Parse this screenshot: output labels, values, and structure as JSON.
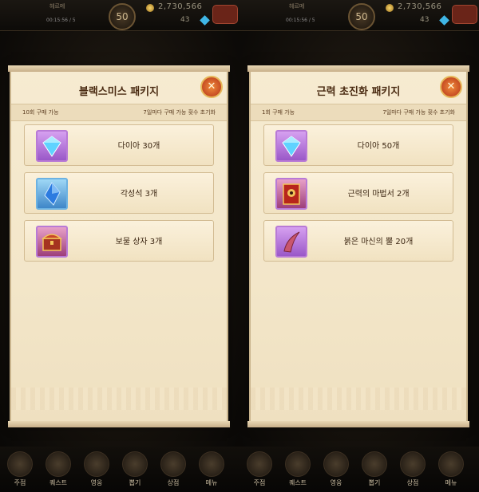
{
  "panels": [
    {
      "hud": {
        "player": "헤르메",
        "timer": "00:15:56 / 5",
        "level": "50",
        "gold": "2,730,566",
        "gems": "43"
      },
      "dialog": {
        "title": "블랙스미스 패키지",
        "purchase_limit": "10회 구매 가능",
        "reset_note": "7일마다 구매 가능 횟수 초기화",
        "items": [
          {
            "label": "다이아 30개",
            "icon": "diamond-icon"
          },
          {
            "label": "각성석 3개",
            "icon": "awakening-stone-icon"
          },
          {
            "label": "보물 상자 3개",
            "icon": "treasure-chest-icon"
          }
        ]
      },
      "nav": [
        "주점",
        "퀘스트",
        "영웅",
        "뽑기",
        "상점",
        "메뉴"
      ]
    },
    {
      "hud": {
        "player": "헤르메",
        "timer": "00:15:56 / 5",
        "level": "50",
        "gold": "2,730,566",
        "gems": "43"
      },
      "dialog": {
        "title": "근력 초진화 패키지",
        "purchase_limit": "1회 구매 가능",
        "reset_note": "7일마다 구매 가능 횟수 초기화",
        "items": [
          {
            "label": "다이아 50개",
            "icon": "diamond-icon"
          },
          {
            "label": "근력의 마법서 2개",
            "icon": "spellbook-icon"
          },
          {
            "label": "붉은 마신의 뿔 20개",
            "icon": "red-horn-icon"
          }
        ]
      },
      "nav": [
        "주점",
        "퀘스트",
        "영웅",
        "뽑기",
        "상점",
        "메뉴"
      ]
    }
  ],
  "colors": {
    "parchment": "#f3e6c9",
    "title_text": "#4b2c13",
    "close_button": "#d0492a"
  }
}
